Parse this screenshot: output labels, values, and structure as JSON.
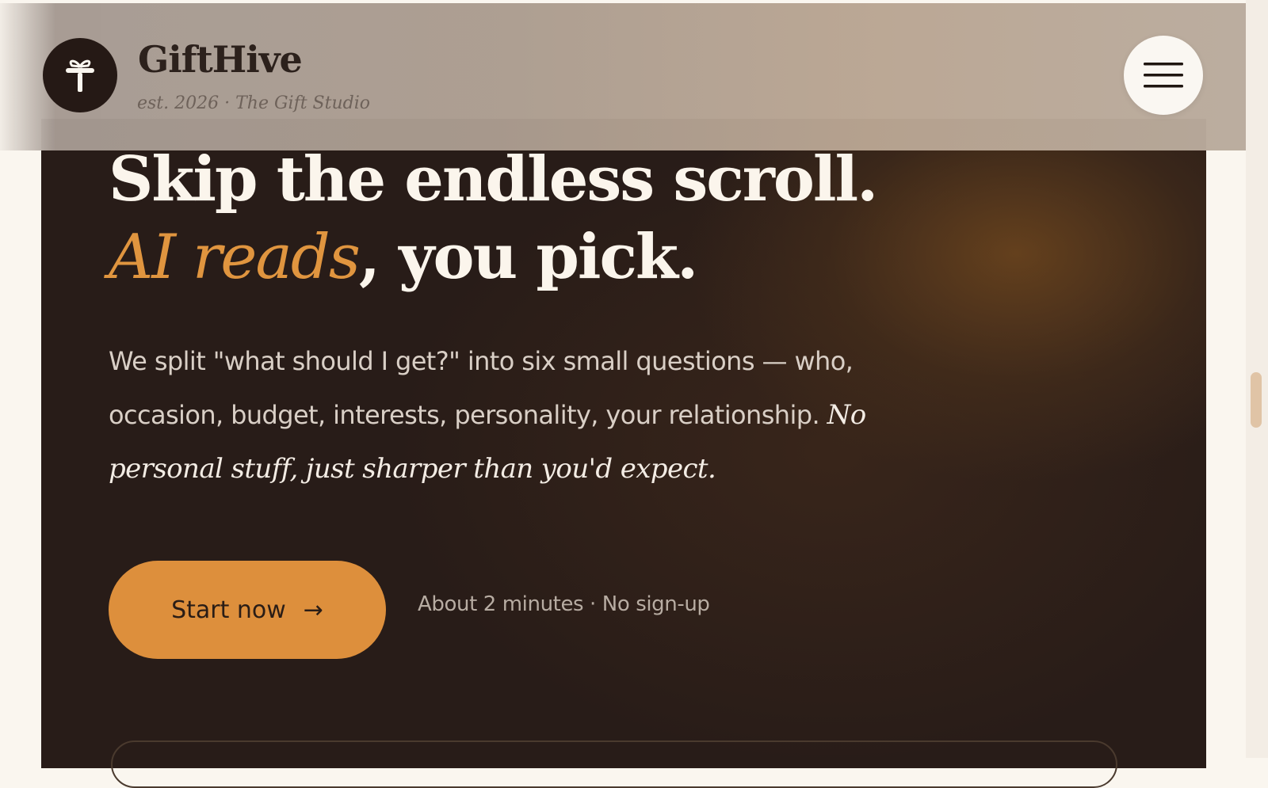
{
  "brand": {
    "name": "GiftHive",
    "tagline": "est. 2026 · The Gift Studio",
    "logo_icon": "gift-icon"
  },
  "header": {
    "menu_icon": "hamburger-icon"
  },
  "hero": {
    "headline_line1": "Skip the endless scroll.",
    "headline_accent": "AI reads",
    "headline_line2_rest": ", you pick.",
    "lede": "We split \"what should I get?\" into six small questions — who, occasion, budget, interests, personality, your relationship.",
    "lede_aside": "No personal stuff, just sharper than you'd expect.",
    "cta_label": "Start now",
    "cta_arrow": "→",
    "cta_note": "About 2 minutes · No sign-up"
  },
  "colors": {
    "accent": "#dd8f3c",
    "hero_bg": "#281c18",
    "headline": "#fbf5ec"
  }
}
